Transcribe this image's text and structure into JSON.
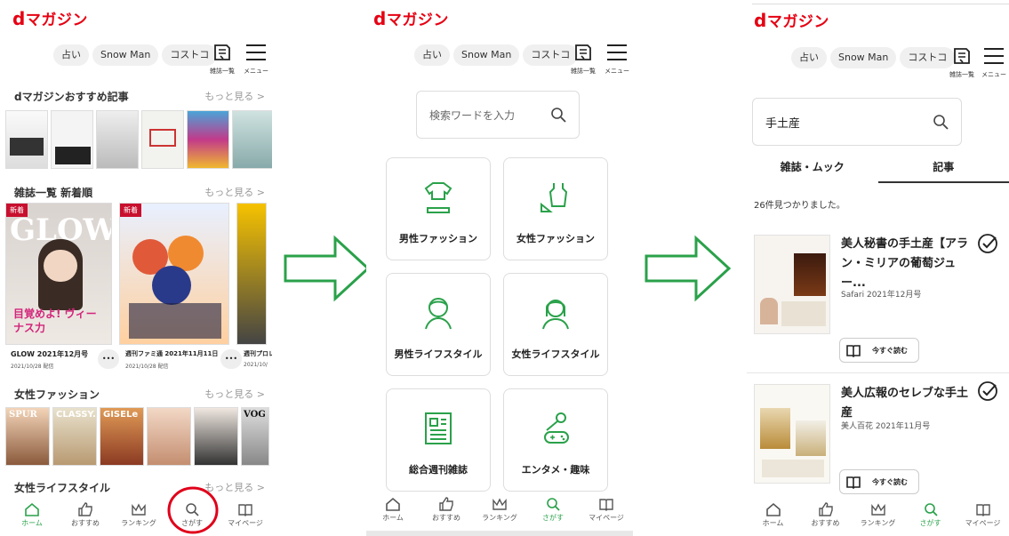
{
  "app": {
    "logo_d": "d",
    "logo_rest": "マガジン"
  },
  "header": {
    "chips": [
      "占い",
      "Snow Man",
      "コストコ"
    ],
    "magazine_list_label": "雑誌一覧",
    "menu_label": "メニュー"
  },
  "home": {
    "sections": [
      {
        "title": "dマガジンおすすめ記事",
        "more": "もっと見る >"
      },
      {
        "title": "雑誌一覧 新着順",
        "more": "もっと見る >"
      },
      {
        "title": "女性ファッション",
        "more": "もっと見る >"
      },
      {
        "title": "女性ライフスタイル",
        "more": "もっと見る >"
      }
    ],
    "new_badge": "新着",
    "covers": [
      {
        "name": "GLOW 2021年12月号",
        "date": "2021/10/28 配信",
        "cover_text": "GLOW",
        "headline": "目覚めよ! ヴィーナス力"
      },
      {
        "name": "週刊ファミ通 2021年11月11日",
        "date": "2021/10/28 配信"
      },
      {
        "name": "週刊プロレ",
        "date": "2021/10/"
      }
    ],
    "more_dots": "•••",
    "fashion_covers": [
      "SPUR",
      "CLASSY.",
      "GISELe",
      "",
      "",
      "VOG"
    ]
  },
  "search": {
    "placeholder": "検索ワードを入力",
    "categories": [
      "男性ファッション",
      "女性ファッション",
      "男性ライフスタイル",
      "女性ライフスタイル",
      "総合週刊雑誌",
      "エンタメ・趣味"
    ]
  },
  "results": {
    "query": "手土産",
    "tabs": [
      "雑誌・ムック",
      "記事"
    ],
    "count_text": "26件見つかりました。",
    "items": [
      {
        "title": "美人秘書の手土産【アラン・ミリアの葡萄ジュー...",
        "source": "Safari 2021年12月号",
        "read": "今すぐ読む"
      },
      {
        "title": "美人広報のセレブな手土産",
        "source": "美人百花 2021年11月号",
        "read": "今すぐ読む"
      }
    ]
  },
  "tabbar": [
    "ホーム",
    "おすすめ",
    "ランキング",
    "さがす",
    "マイページ"
  ],
  "colors": {
    "brand": "#e60012",
    "accent": "#2aa14a",
    "highlight_circle": "#e0001a"
  }
}
